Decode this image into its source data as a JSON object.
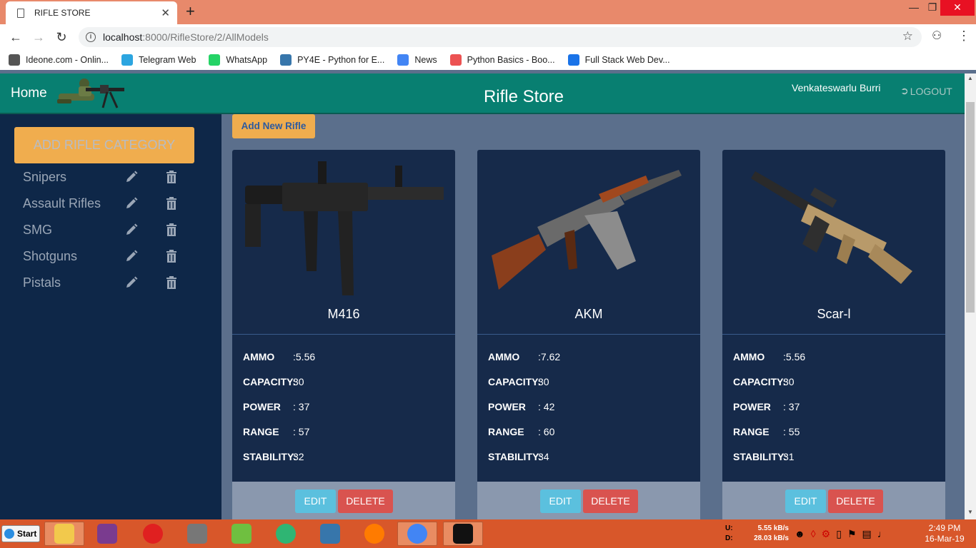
{
  "browser": {
    "tab_title": "RIFLE STORE",
    "tab_close": "✕",
    "new_tab": "+",
    "url_host": "localhost",
    "url_rest": ":8000/RifleStore/2/AllModels",
    "window_controls": [
      "—",
      "❐",
      "✕"
    ],
    "bookmarks": [
      {
        "label": "Ideone.com - Onlin...",
        "icon": "ideone-icon",
        "color": "#555555"
      },
      {
        "label": "Telegram Web",
        "icon": "telegram-icon",
        "color": "#2ca5e0"
      },
      {
        "label": "WhatsApp",
        "icon": "whatsapp-icon",
        "color": "#25d366"
      },
      {
        "label": "PY4E - Python for E...",
        "icon": "python-icon",
        "color": "#3776ab"
      },
      {
        "label": "News",
        "icon": "news-icon",
        "color": "#4285f4"
      },
      {
        "label": "Python Basics - Boo...",
        "icon": "udemy-icon",
        "color": "#ec5252"
      },
      {
        "label": "Full Stack Web Dev...",
        "icon": "u-icon",
        "color": "#1a73e8"
      }
    ]
  },
  "header": {
    "home_label": "Home",
    "title": "Rifle Store",
    "username": "Venkateswarlu Burri",
    "logout_label": "LOGOUT"
  },
  "sidebar": {
    "add_category_label": "ADD RIFLE CATEGORY",
    "categories": [
      {
        "label": "Snipers"
      },
      {
        "label": "Assault Rifles"
      },
      {
        "label": "SMG"
      },
      {
        "label": "Shotguns"
      },
      {
        "label": "Pistals"
      }
    ]
  },
  "main": {
    "add_rifle_label": "Add New Rifle",
    "edit_label": "EDIT",
    "delete_label": "DELETE",
    "stat_labels": {
      "ammo": "AMMO",
      "capacity": "CAPACITY:",
      "power": "POWER",
      "range": "RANGE",
      "stability": "STABILITY:"
    },
    "rifles": [
      {
        "name": "M416",
        "ammo": ":5.56",
        "capacity": "30",
        "power": ": 37",
        "range": ": 57",
        "stability": "32"
      },
      {
        "name": "AKM",
        "ammo": ":7.62",
        "capacity": "30",
        "power": ": 42",
        "range": ": 60",
        "stability": "34"
      },
      {
        "name": "Scar-l",
        "ammo": ":5.56",
        "capacity": "30",
        "power": ": 37",
        "range": ": 55",
        "stability": "31"
      }
    ]
  },
  "taskbar": {
    "start_label": "Start",
    "net_upload_label": "U:",
    "net_download_label": "D:",
    "net_upload": "5.55 kB/s",
    "net_download": "28.03 kB/s",
    "time": "2:49 PM",
    "date": "16-Mar-19",
    "apps": [
      {
        "name": "file-explorer-icon",
        "color": "#f2c94c"
      },
      {
        "name": "media-player-icon",
        "color": "#7a3b8f"
      },
      {
        "name": "opera-icon",
        "color": "#e02020"
      },
      {
        "name": "database-icon",
        "color": "#777777"
      },
      {
        "name": "notepadpp-icon",
        "color": "#6fbf40"
      },
      {
        "name": "atom-icon",
        "color": "#2fb573"
      },
      {
        "name": "python-idle-icon",
        "color": "#3776ab"
      },
      {
        "name": "firefox-icon",
        "color": "#ff7b00"
      },
      {
        "name": "chrome-icon",
        "color": "#4285f4"
      },
      {
        "name": "cmd-icon",
        "color": "#111111"
      }
    ]
  }
}
